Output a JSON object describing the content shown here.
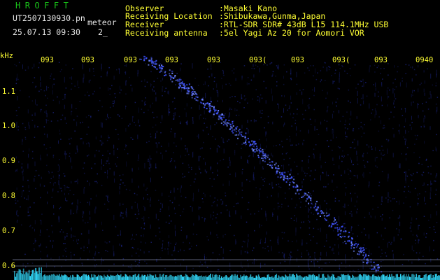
{
  "header": {
    "logo": "HROFFT",
    "file_name": "UT2507130930.pn",
    "meteor_label": "meteor",
    "datetime": "25.07.13 09:30",
    "count": "2_"
  },
  "info": [
    {
      "label": "Observer",
      "value": ":Masaki Kano"
    },
    {
      "label": "Receiving Location",
      "value": ":Shibukawa,Gunma,Japan"
    },
    {
      "label": "Receiver",
      "value": ":RTL-SDR SDR# 43dB L15 114.1MHz USB"
    },
    {
      "label": "Receiving antenna",
      "value": ":5el Yagi Az 20 for Aomori VOR"
    }
  ],
  "axis": {
    "unit": "kHz",
    "x_ticks": [
      "093",
      "093",
      "093",
      "093",
      "093",
      "093(",
      "093",
      "093(",
      "093",
      "0940"
    ],
    "y_ticks": [
      "1.1",
      "1.0",
      "0.9",
      "0.8",
      "0.7",
      "0.6"
    ]
  },
  "colors": {
    "background": "#000000",
    "text": "#ffff33",
    "logo": "#19c219",
    "signal": "#3c50ff",
    "noise": "#1f2a9a",
    "baseline": "#33ddff"
  }
}
